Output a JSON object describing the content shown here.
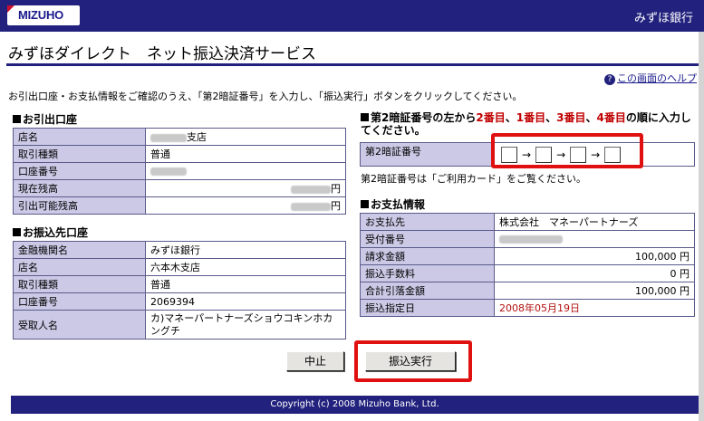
{
  "header": {
    "logo_text": "MIZUHO",
    "bank_name": "みずほ銀行"
  },
  "page": {
    "title": "みずほダイレクト　ネット振込決済サービス",
    "help_label": "この画面のヘルプ",
    "instruction": "お引出口座・お支払情報をご確認のうえ、「第2暗証番号」を入力し、「振込実行」ボタンをクリックしてください。"
  },
  "withdrawal": {
    "heading": "お引出口座",
    "rows": [
      {
        "label": "店名",
        "value": "支店"
      },
      {
        "label": "取引種類",
        "value": "普通"
      },
      {
        "label": "口座番号",
        "value": ""
      },
      {
        "label": "現在残高",
        "value": "円"
      },
      {
        "label": "引出可能残高",
        "value": "円"
      }
    ]
  },
  "transfer": {
    "heading": "お振込先口座",
    "rows": [
      {
        "label": "金融機関名",
        "value": "みずほ銀行"
      },
      {
        "label": "店名",
        "value": "六本木支店"
      },
      {
        "label": "取引種類",
        "value": "普通"
      },
      {
        "label": "口座番号",
        "value": "2069394"
      },
      {
        "label": "受取人名",
        "value": "カ)マネーパートナーズショウコキンホカングチ"
      }
    ]
  },
  "pin": {
    "heading_prefix": "第2暗証番号の左から",
    "ord1": "2番目",
    "ord2": "1番目",
    "ord3": "3番目",
    "ord4": "4番目",
    "sep": "、",
    "heading_suffix": "の順に入力してください。",
    "label": "第2暗証番号",
    "arrow": "→",
    "note": "第2暗証番号は「ご利用カード」をご覧ください。"
  },
  "payment": {
    "heading": "お支払情報",
    "rows": [
      {
        "label": "お支払先",
        "value": "株式会社　マネーパートナーズ"
      },
      {
        "label": "受付番号",
        "value": ""
      },
      {
        "label": "請求金額",
        "value": "100,000 円"
      },
      {
        "label": "振込手数料",
        "value": "0 円"
      },
      {
        "label": "合計引落金額",
        "value": "100,000 円"
      },
      {
        "label": "振込指定日",
        "value": "2008年05月19日"
      }
    ]
  },
  "buttons": {
    "cancel": "中止",
    "execute": "振込実行"
  },
  "footer": {
    "copyright": "Copyright (c) 2008 Mizuho Bank, Ltd."
  },
  "colors": {
    "navy": "#22227e",
    "label_bg": "#ccc9e6",
    "highlight": "#e01010",
    "emphasis": "#c00000"
  }
}
